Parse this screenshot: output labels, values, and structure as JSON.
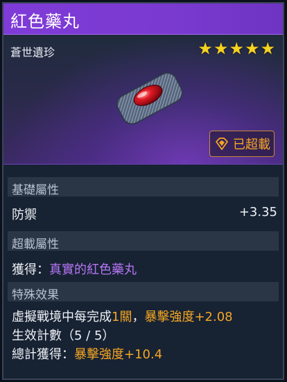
{
  "header": {
    "title": "紅色藥丸"
  },
  "hero": {
    "rarity_label": "蒼世遺珍",
    "stars": "★★★★★",
    "overload_badge": "已超載",
    "colors": {
      "star": "#f7d21e",
      "accent_orange": "#f5a623",
      "accent_purple": "#b676f5"
    }
  },
  "base_attributes": {
    "title": "基礎屬性",
    "stat_name": "防禦",
    "stat_value": "+3.35"
  },
  "overload_attributes": {
    "title": "超載屬性",
    "obtain_prefix": "獲得：",
    "obtain_value": "真實的紅色藥丸"
  },
  "special_effect": {
    "title": "特殊效果",
    "line1_prefix": "虛擬戰境中每完成",
    "line1_count": "1關",
    "line1_sep": "，",
    "line1_effect": "暴擊強度+2.08",
    "line2": "生效計數（5 / 5）",
    "line3_prefix": "總計獲得：",
    "line3_effect": "暴擊強度+10.4"
  }
}
